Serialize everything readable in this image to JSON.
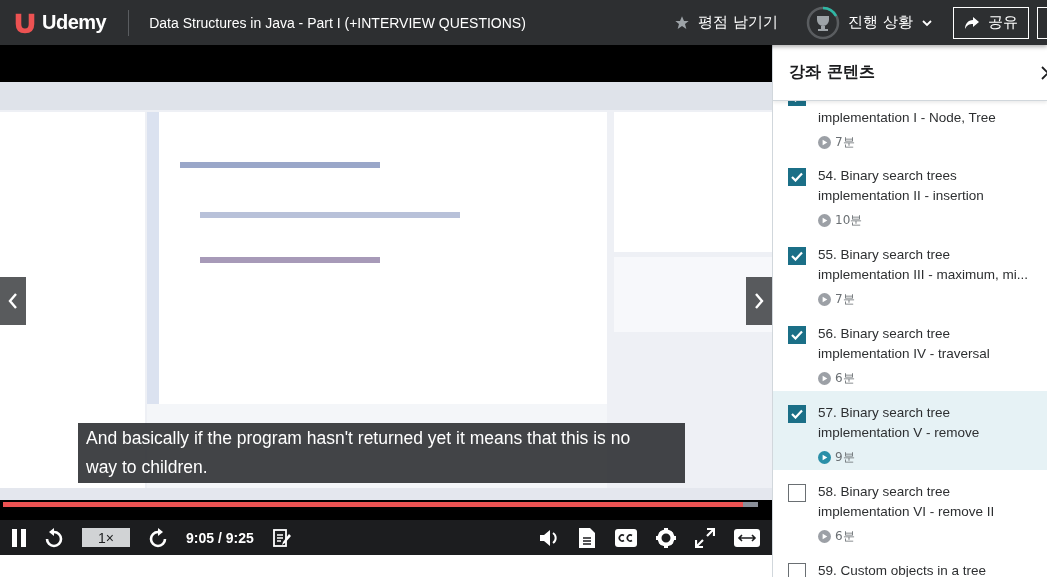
{
  "header": {
    "logo": "Udemy",
    "course_title": "Data Structures in Java - Part I (+INTERVIEW QUESTIONS)",
    "rate_label": "평점 남기기",
    "progress_label": "진행 상황",
    "share_label": "공유"
  },
  "player": {
    "subtitle": "And basically if the program hasn't returned yet it means that this is no way to children.",
    "progress": {
      "level": 0.98
    },
    "speed": "1×",
    "time": "9:05 / 9:25"
  },
  "sidebar": {
    "title": "강좌 콘텐츠",
    "lectures": [
      {
        "title": "implementation I - Node, Tree",
        "duration": "7분",
        "checked": true,
        "selected": false
      },
      {
        "title": "54. Binary search trees implementation II - insertion",
        "duration": "10분",
        "checked": true,
        "selected": false
      },
      {
        "title": "55. Binary search tree implementation III - maximum, mi...",
        "duration": "7분",
        "checked": true,
        "selected": false
      },
      {
        "title": "56. Binary search tree implementation IV - traversal",
        "duration": "6분",
        "checked": true,
        "selected": false
      },
      {
        "title": "57. Binary search tree implementation V - remove",
        "duration": "9분",
        "checked": true,
        "selected": true
      },
      {
        "title": "58. Binary search tree implementation VI - remove II",
        "duration": "6분",
        "checked": false,
        "selected": false
      },
      {
        "title": "59. Custom objects in a tree",
        "checked": false,
        "selected": false
      }
    ]
  }
}
